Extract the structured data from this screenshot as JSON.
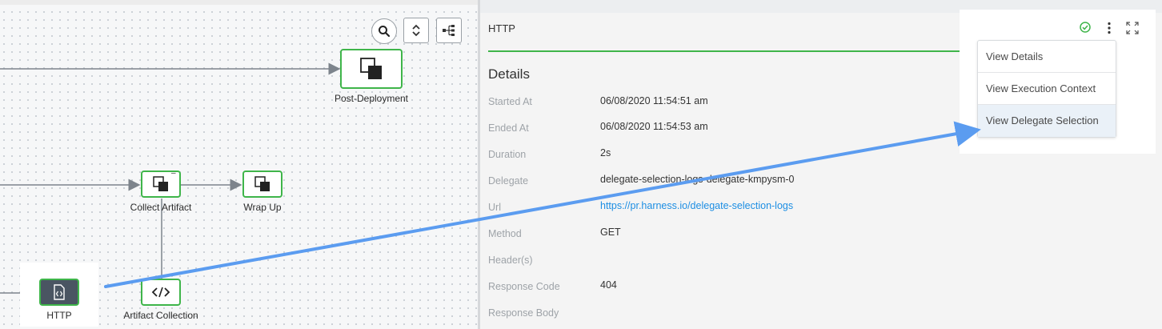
{
  "canvas": {
    "tools": {
      "search_icon": "search-icon",
      "expand_icon": "expand-collapse-icon",
      "layout_icon": "tree-layout-icon"
    },
    "nodes": {
      "post_deployment": "Post-Deployment",
      "collect_artifact": "Collect Artifact",
      "wrap_up": "Wrap Up",
      "http": "HTTP",
      "artifact_collection": "Artifact Collection"
    },
    "collapse_marker": "–"
  },
  "panel": {
    "title": "HTTP",
    "heading": "Details",
    "rows": [
      {
        "label": "Started At",
        "value": "06/08/2020 11:54:51 am"
      },
      {
        "label": "Ended At",
        "value": "06/08/2020 11:54:53 am"
      },
      {
        "label": "Duration",
        "value": "2s"
      },
      {
        "label": "Delegate",
        "value": "delegate-selection-logs-delegate-kmpysm-0"
      },
      {
        "label": "Url",
        "value": "https://pr.harness.io/delegate-selection-logs"
      },
      {
        "label": "Method",
        "value": "GET"
      },
      {
        "label": "Header(s)",
        "value": ""
      },
      {
        "label": "Response Code",
        "value": "404"
      },
      {
        "label": "Response Body",
        "value": ""
      }
    ],
    "status_color": "#3fb54a",
    "link_color": "#1d8ee3"
  },
  "header_actions": {
    "status_icon": "check-circle-icon",
    "more_icon": "more-vertical-icon",
    "maximize_icon": "maximize-icon"
  },
  "menu": {
    "items": [
      {
        "label": "View Details"
      },
      {
        "label": "View Execution Context"
      },
      {
        "label": "View Delegate Selection"
      }
    ],
    "active_index": 2
  },
  "annotation": {
    "arrow_color": "#5b9cf0"
  }
}
